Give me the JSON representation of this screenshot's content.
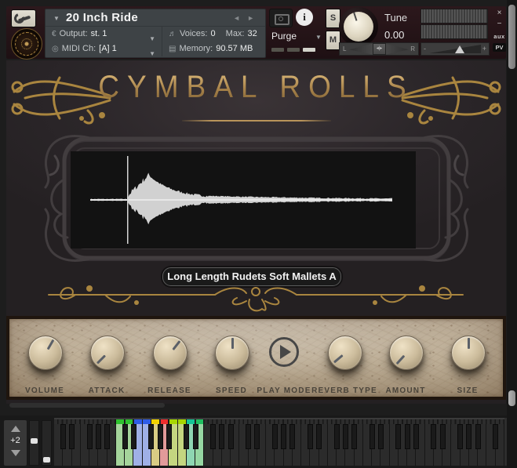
{
  "header": {
    "instrument_title": "20 Inch Ride",
    "output_label": "Output:",
    "output_value": "st. 1",
    "midi_label": "MIDI Ch:",
    "midi_value": "[A] 1",
    "voices_label": "Voices:",
    "voices_value": "0",
    "max_label": "Max:",
    "max_value": "32",
    "memory_label": "Memory:",
    "memory_value": "90.57 MB",
    "purge_label": "Purge",
    "solo": "S",
    "mute": "M",
    "tune_label": "Tune",
    "tune_value": "0.00",
    "pan_left": "L",
    "pan_right": "R",
    "vol_minus": "-",
    "vol_plus": "+",
    "close": "×",
    "minimize": "−",
    "aux": "aux",
    "pv": "PV",
    "icons": {
      "output": "€",
      "midi": "◎",
      "voices": "♬",
      "memory": "▤",
      "title_caret": "▼",
      "row_caret": "▼",
      "nav_prev": "◄",
      "nav_next": "►",
      "info": "i"
    },
    "purge_meter_colors": [
      "#54534b",
      "#54534b",
      "#d2d2ca"
    ]
  },
  "instrument": {
    "title": "CYMBAL ROLLS",
    "sample_name": "Long Length Rudets Soft Mallets A",
    "controls": [
      {
        "label": "VOLUME",
        "type": "knob",
        "angle": 30
      },
      {
        "label": "ATTACK",
        "type": "knob",
        "angle": -135
      },
      {
        "label": "RELEASE",
        "type": "knob",
        "angle": 38
      },
      {
        "label": "SPEED",
        "type": "knob",
        "angle": 0
      },
      {
        "label": "PLAY MODE",
        "type": "play-button"
      },
      {
        "label": "REVERB TYPE",
        "type": "knob",
        "angle": -130
      },
      {
        "label": "AMOUNT",
        "type": "knob",
        "angle": -138
      },
      {
        "label": "SIZE",
        "type": "knob",
        "angle": 0
      }
    ],
    "colors": {
      "gold": "#b28b4e",
      "parchment": "#cdc1aa",
      "frame": "#454042",
      "waveform": "#dcdcdc"
    }
  },
  "keyboard": {
    "octave_shift": "+2",
    "white_key_count": 51,
    "first_note": "C",
    "colored_start_index": 7,
    "colored_keys": [
      {
        "body": "#a5d49b",
        "strip": "#2ec22e"
      },
      {
        "body": "#a5d49b",
        "strip": "#2ec22e"
      },
      {
        "body": "#9fb0e6",
        "strip": "#2e5ce6"
      },
      {
        "body": "#9fb0e6",
        "strip": "#2e5ce6"
      },
      {
        "body": "#d8cc84",
        "strip": "#f2d200"
      },
      {
        "body": "#e29a9a",
        "strip": "#ef2d2d"
      },
      {
        "body": "#c4d680",
        "strip": "#a6d600"
      },
      {
        "body": "#c4d680",
        "strip": "#a6d600"
      },
      {
        "body": "#8ed6b2",
        "strip": "#14c595"
      },
      {
        "body": "#96d6a2",
        "strip": "#1fbf60"
      }
    ]
  }
}
